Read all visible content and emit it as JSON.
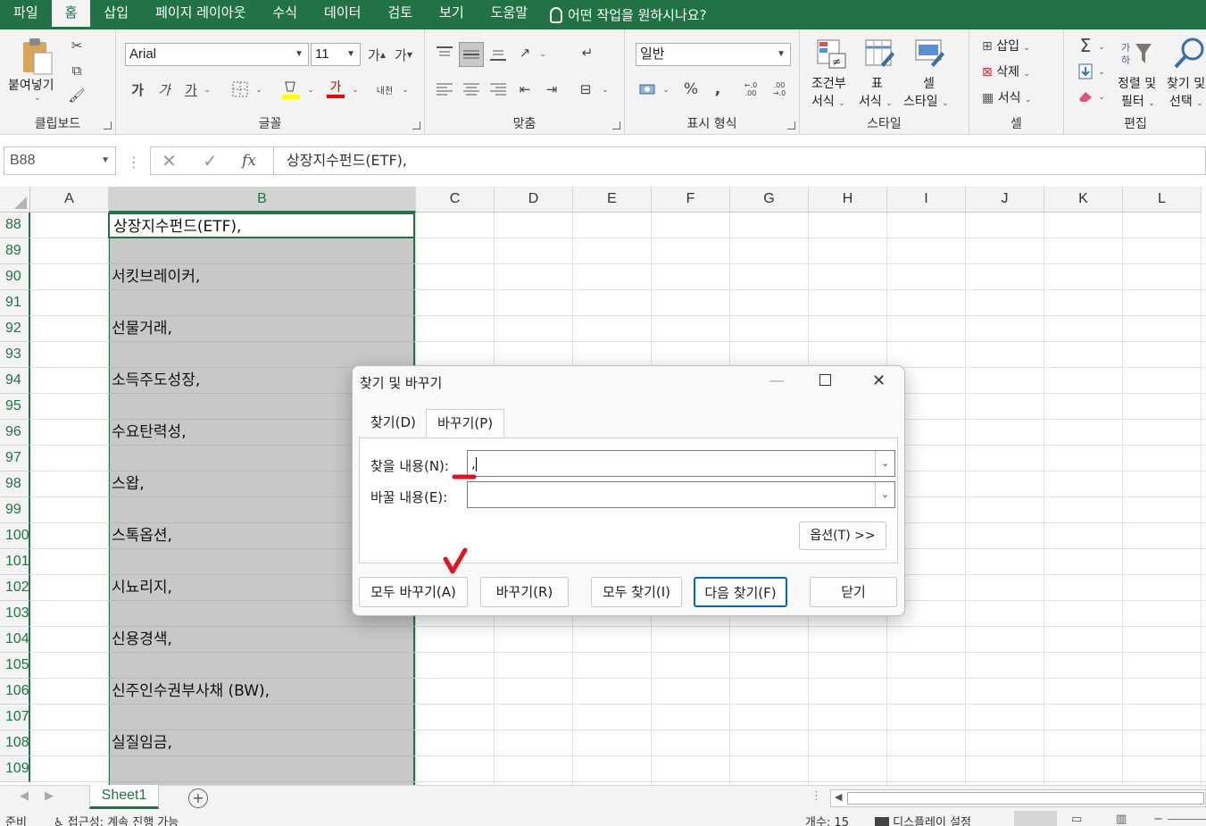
{
  "menu": {
    "tabs": [
      "파일",
      "홈",
      "삽입",
      "페이지 레이아웃",
      "수식",
      "데이터",
      "검토",
      "보기",
      "도움말"
    ],
    "active_tab": "홈",
    "tell_me": "어떤 작업을 원하시나요?"
  },
  "ribbon": {
    "clipboard": {
      "paste": "붙여넣기",
      "label": "클립보드"
    },
    "font": {
      "name": "Arial",
      "size": "11",
      "grow": "가",
      "shrink": "가",
      "bold": "가",
      "italic": "가",
      "underline": "가",
      "color_letter": "가",
      "phonetic": "내천",
      "label": "글꼴"
    },
    "alignment": {
      "label": "맞춤"
    },
    "number": {
      "format": "일반",
      "percent": "%",
      "comma": ",",
      "inc_decimal": "←.0 .00",
      "dec_decimal": ".00 →.0",
      "label": "표시 형식"
    },
    "styles": {
      "conditional": [
        "조건부",
        "서식"
      ],
      "table": [
        "표",
        "서식"
      ],
      "cell": [
        "셀",
        "스타일"
      ],
      "label": "스타일"
    },
    "cells": {
      "insert": "삽입",
      "delete": "삭제",
      "format": "서식",
      "label": "셀"
    },
    "editing": {
      "sum": "Σ",
      "sort": [
        "정렬 및",
        "필터"
      ],
      "find": [
        "찾기 및",
        "선택"
      ],
      "label": "편집"
    }
  },
  "formula_bar": {
    "name_box": "B88",
    "content": "상장지수펀드(ETF),"
  },
  "sheet": {
    "columns": [
      "A",
      "B",
      "C",
      "D",
      "E",
      "F",
      "G",
      "H",
      "I",
      "J",
      "K",
      "L"
    ],
    "rows": [
      "88",
      "89",
      "90",
      "91",
      "92",
      "93",
      "94",
      "95",
      "96",
      "97",
      "98",
      "99",
      "100",
      "101",
      "102",
      "103",
      "104",
      "105",
      "106",
      "107",
      "108",
      "109"
    ],
    "b_values": [
      "상장지수펀드(ETF),",
      "",
      "서킷브레이커,",
      "",
      "선물거래,",
      "",
      "소득주도성장,",
      "",
      "수요탄력성,",
      "",
      "스왑,",
      "",
      "스톡옵션,",
      "",
      "시뇨리지,",
      "",
      "신용경색,",
      "",
      "신주인수권부사채 (BW),",
      "",
      "실질임금,",
      ""
    ],
    "selected_column": "B",
    "active_cell": "B88",
    "sheet_tab": "Sheet1"
  },
  "status": {
    "ready": "준비",
    "accessibility": "접근성: 계속 진행 가능",
    "count": "개수: 15",
    "display": "디스플레이 설정"
  },
  "dialog": {
    "title": "찾기 및 바꾸기",
    "tabs": [
      "찾기(D)",
      "바꾸기(P)"
    ],
    "active_tab": "바꾸기(P)",
    "find_label": "찾을 내용(N):",
    "find_value": ",",
    "replace_label": "바꿀 내용(E):",
    "replace_value": "",
    "options_button": "옵션(T) >>",
    "buttons": [
      "모두 바꾸기(A)",
      "바꾸기(R)",
      "모두 찾기(I)",
      "다음 찾기(F)",
      "닫기"
    ],
    "default_button": "다음 찾기(F)"
  },
  "colors": {
    "excel_green": "#217346",
    "selection_gray": "#c8c8c8",
    "annotation_red": "#e0141e",
    "dialog_default_blue": "#0067c0"
  }
}
